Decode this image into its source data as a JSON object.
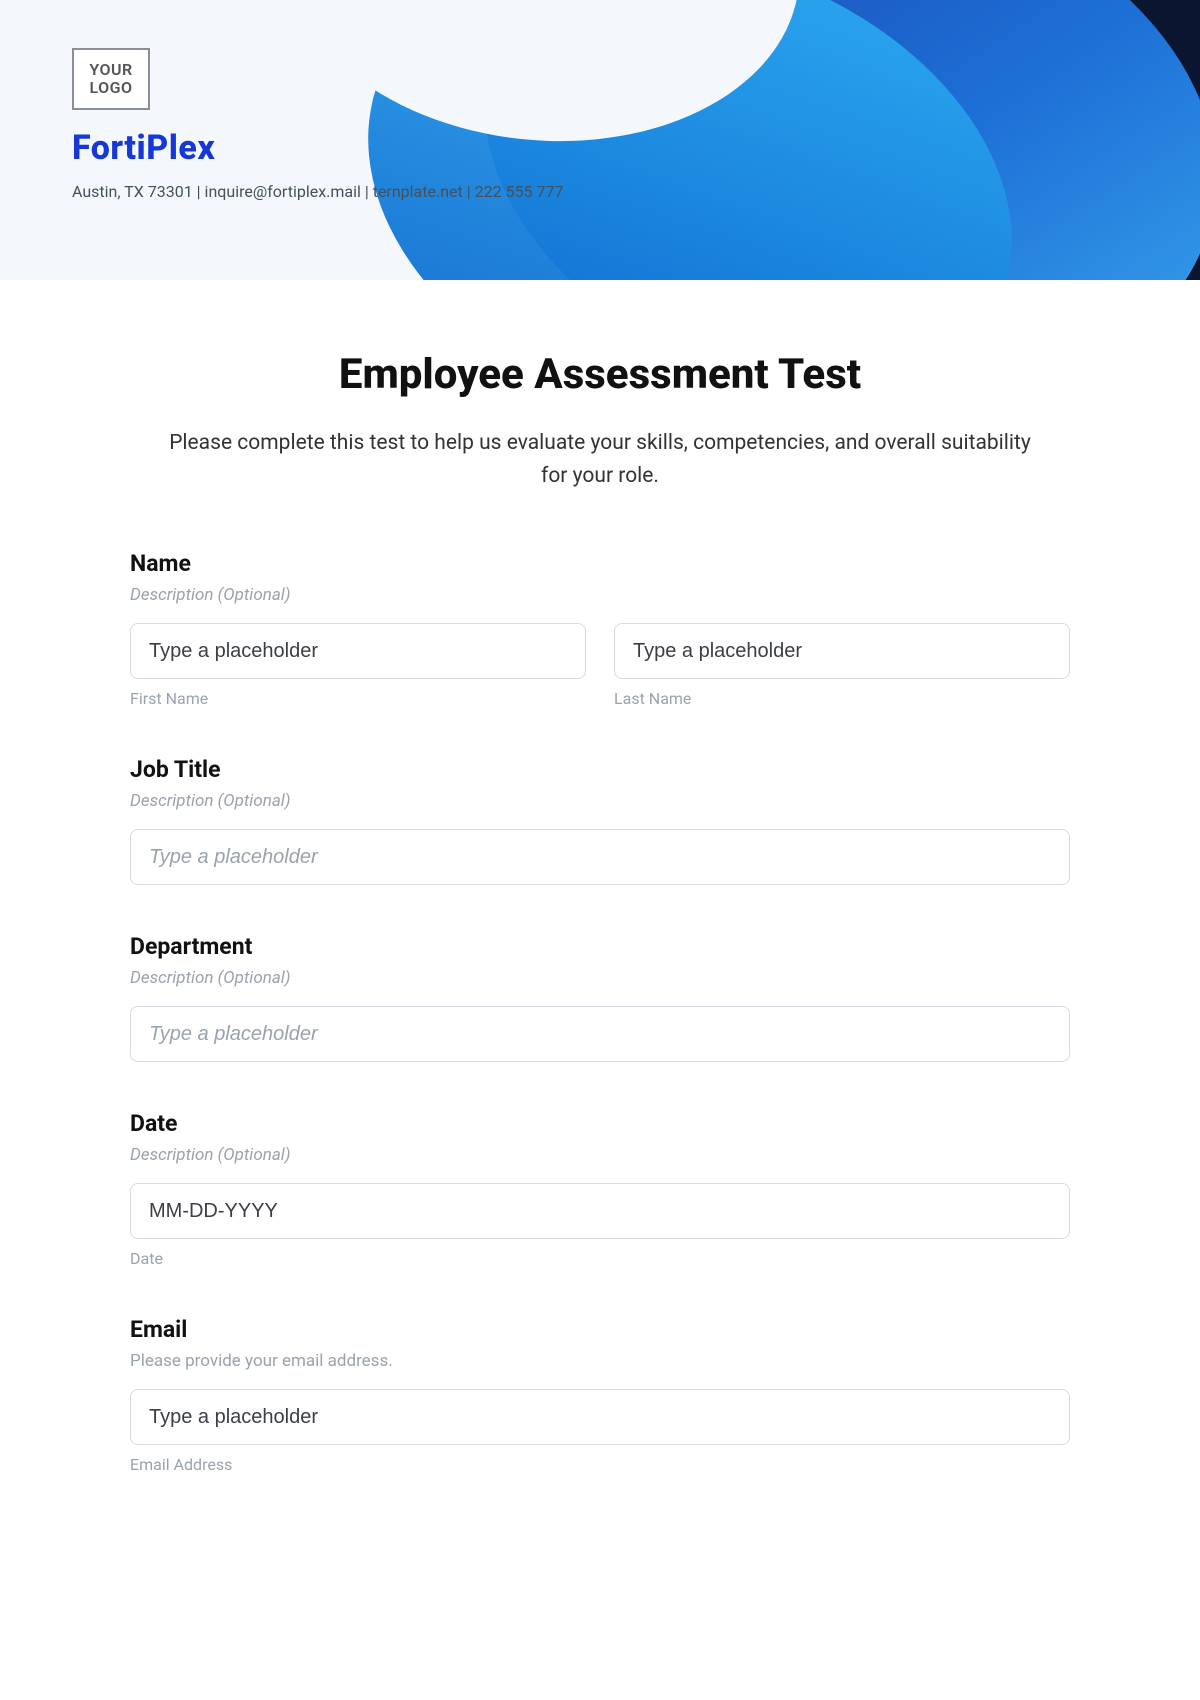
{
  "brand": {
    "logo_text": "YOUR\nLOGO",
    "name": "FortiPlex",
    "meta": "Austin, TX 73301 | inquire@fortiplex.mail | ternplate.net | 222 555 777"
  },
  "form": {
    "title": "Employee Assessment Test",
    "intro": "Please complete this test to help us evaluate your skills, competencies, and overall suitability for your role.",
    "name": {
      "label": "Name",
      "desc": "Description (Optional)",
      "first_placeholder": "Type a placeholder",
      "first_sub": "First Name",
      "last_placeholder": "Type a placeholder",
      "last_sub": "Last Name"
    },
    "job": {
      "label": "Job Title",
      "desc": "Description (Optional)",
      "placeholder": "Type a placeholder"
    },
    "dept": {
      "label": "Department",
      "desc": "Description (Optional)",
      "placeholder": "Type a placeholder"
    },
    "date": {
      "label": "Date",
      "desc": "Description (Optional)",
      "placeholder": "MM-DD-YYYY",
      "sub": "Date"
    },
    "email": {
      "label": "Email",
      "desc": "Please provide your email address.",
      "placeholder": "Type a placeholder",
      "sub": "Email Address"
    }
  }
}
